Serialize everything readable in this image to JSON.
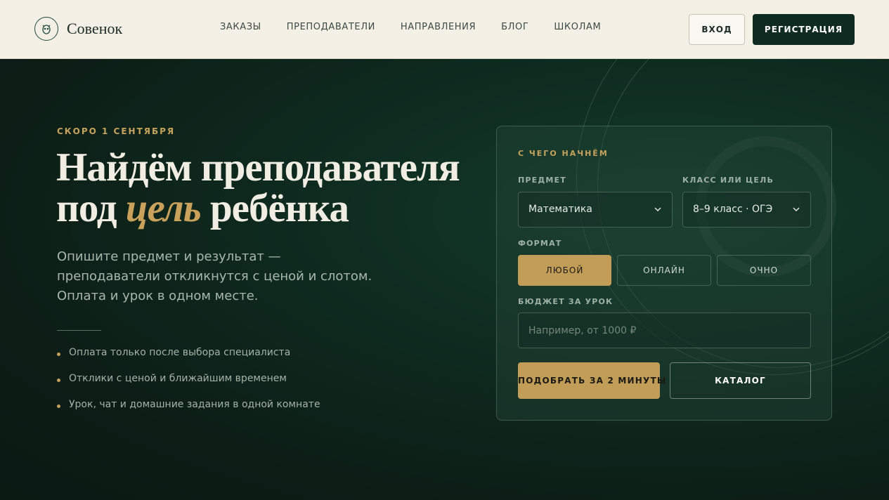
{
  "brand": {
    "name": "Совенок"
  },
  "nav": {
    "items": [
      {
        "label": "ЗАКАЗЫ"
      },
      {
        "label": "ПРЕПОДАВАТЕЛИ"
      },
      {
        "label": "НАПРАВЛЕНИЯ"
      },
      {
        "label": "БЛОГ"
      },
      {
        "label": "ШКОЛАМ"
      }
    ],
    "login_label": "ВХОД",
    "register_label": "РЕГИСТРАЦИЯ"
  },
  "hero": {
    "eyebrow": "СКОРО 1 СЕНТЯБРЯ",
    "headline_line1": "Найдём преподавателя",
    "headline_prefix": "под ",
    "headline_accent": "цель",
    "headline_suffix": " ребёнка",
    "lead": "Опишите предмет и результат — преподаватели откликнутся с ценой и слотом. Оплата и урок в одном месте.",
    "bullets": [
      "Оплата только после выбора специалиста",
      "Отклики с ценой и ближайшим временем",
      "Урок, чат и домашние задания в одной комнате"
    ]
  },
  "form": {
    "title": "С ЧЕГО НАЧНЁМ",
    "subject_label": "ПРЕДМЕТ",
    "subject_value": "Математика",
    "grade_label": "КЛАСС ИЛИ ЦЕЛЬ",
    "grade_value": "8–9 класс · ОГЭ",
    "format_label": "ФОРМАТ",
    "format_options": [
      "ЛЮБОЙ",
      "ОНЛАЙН",
      "ОЧНО"
    ],
    "format_selected": "ЛЮБОЙ",
    "budget_label": "БЮДЖЕТ ЗА УРОК",
    "budget_placeholder": "Например, от 1000 ₽",
    "budget_value": "",
    "submit_label": "ПОДОБРАТЬ ЗА 2 МИНУТЫ",
    "catalog_label": "КАТАЛОГ"
  },
  "colors": {
    "accent_gold": "#c29d58",
    "header_bg": "#f4f0e6",
    "hero_bg": "#0f2c21",
    "dark_button": "#0f2a20"
  }
}
